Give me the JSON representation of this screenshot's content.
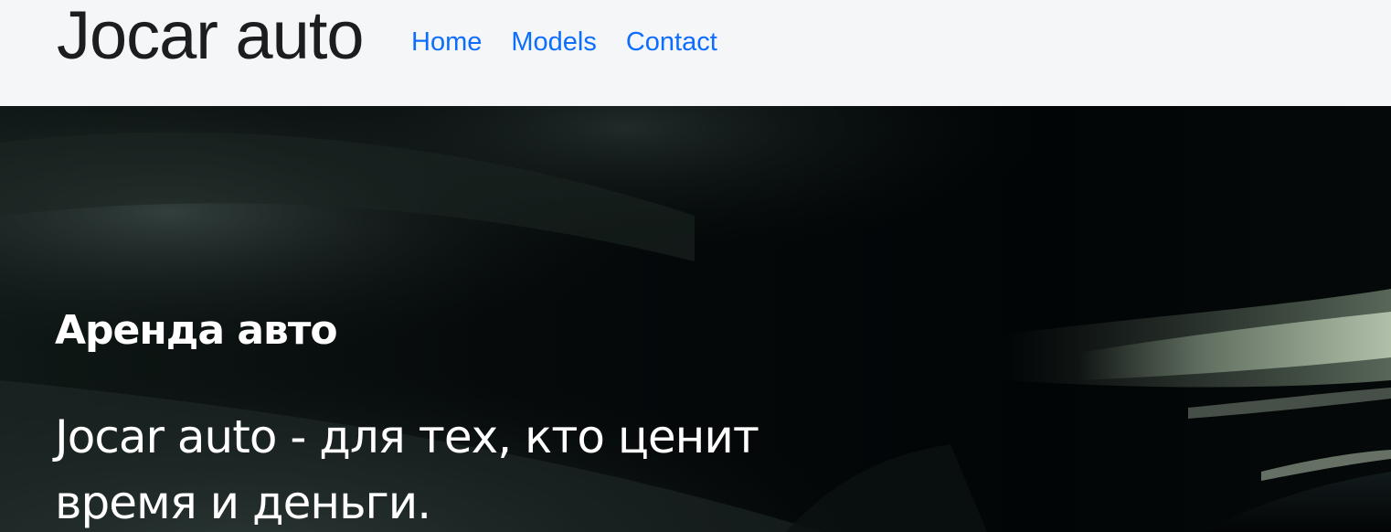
{
  "navbar": {
    "brand": "Jocar auto",
    "links": [
      {
        "label": "Home"
      },
      {
        "label": "Models"
      },
      {
        "label": "Contact"
      }
    ],
    "background": "#f5f6f8",
    "link_color": "#0d6efd"
  },
  "hero": {
    "subtitle": "Аренда авто",
    "title": "Jocar auto - для тех, кто ценит время и деньги.",
    "text_color": "#ffffff",
    "background_image": "dark motion-blurred car photo"
  }
}
